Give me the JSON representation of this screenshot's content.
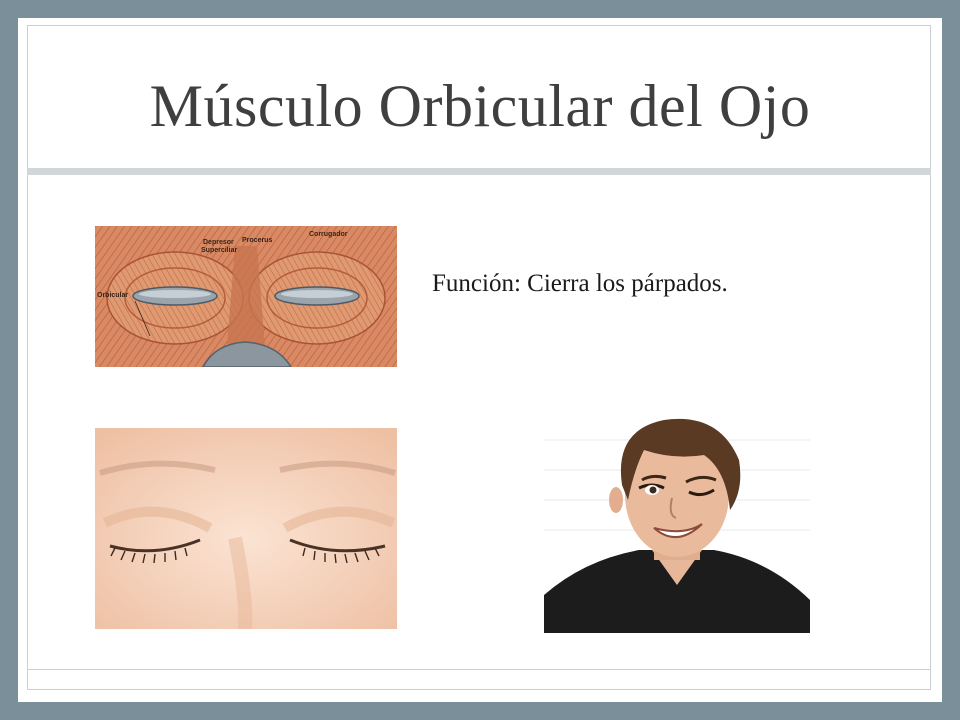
{
  "slide": {
    "title": "Músculo Orbicular del Ojo",
    "body_text": "Función: Cierra los párpados."
  },
  "images": {
    "anatomy": {
      "icon": "facial-muscle-anatomy-illustration",
      "labels": {
        "depresor_line1": "Depresor",
        "depresor_line2": "Superciliar",
        "procerus": "Procerus",
        "corrugador": "Corrugador",
        "orbicular": "Orbicular"
      }
    },
    "closed_eyes": {
      "icon": "closed-eyes-photo"
    },
    "winking_man": {
      "icon": "winking-man-photo"
    }
  },
  "colors": {
    "frame_background": "#7b8f9a",
    "slide_background": "#ffffff",
    "title_rule": "#d1d6d9",
    "title_text": "#3f3f3f"
  }
}
